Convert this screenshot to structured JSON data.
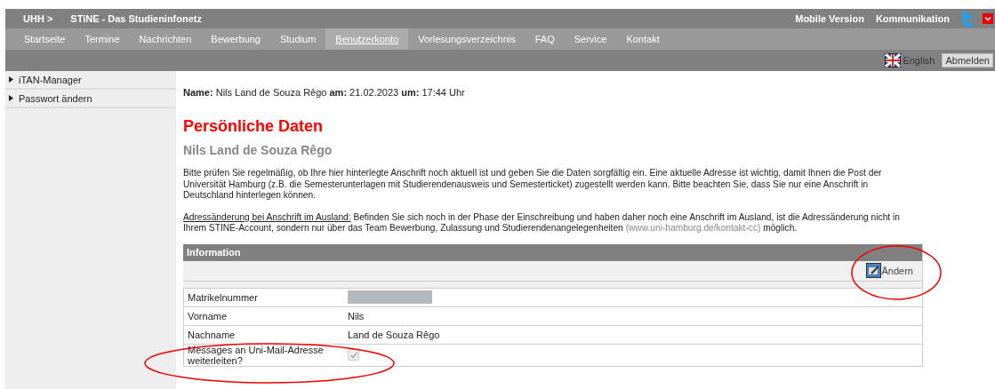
{
  "header": {
    "breadcrumb": "UHH >",
    "title": "STiNE - Das Studieninfonetz",
    "links": [
      "Mobile Version",
      "Kommunikation"
    ]
  },
  "nav": [
    {
      "label": "Startseite",
      "selected": false
    },
    {
      "label": "Termine",
      "selected": false
    },
    {
      "label": "Nachrichten",
      "selected": false
    },
    {
      "label": "Bewerbung",
      "selected": false
    },
    {
      "label": "Studium",
      "selected": false
    },
    {
      "label": "Benutzerkonto",
      "selected": true
    },
    {
      "label": "Vorlesungsverzeichnis",
      "selected": false
    },
    {
      "label": "FAQ",
      "selected": false
    },
    {
      "label": "Service",
      "selected": false
    },
    {
      "label": "Kontakt",
      "selected": false
    }
  ],
  "toolbar": {
    "language": "English",
    "logout": "Abmelden"
  },
  "sidebar": {
    "items": [
      {
        "label": "iTAN-Manager"
      },
      {
        "label": "Passwort ändern"
      }
    ]
  },
  "content": {
    "login_info": "**Name:** Nils Land de Souza Rêgo **am:** 21.02.2023 **um:** 17:44 Uhr",
    "heading": "Persönliche Daten",
    "subheading": "Nils Land de Souza Rêgo",
    "intro": "Bitte prüfen Sie regelmäßig, ob Ihre hier hinterlegte Anschrift noch aktuell ist und geben Sie die Daten sorgfältig ein. Eine aktuelle Adresse ist wichtig, damit Ihnen die Post der Universität Hamburg (z.B. die Semesterunterlagen mit Studierendenausweis und Semesterticket) zugestellt werden kann. Bitte beachten Sie, dass Sie nur eine Anschrift in Deutschland hinterlegen können.",
    "notice": {
      "label": "Adressänderung bei Anschrift im Ausland:",
      "text": "Befinden Sie sich noch in der Phase der Einschreibung und haben daher noch eine Anschrift im Ausland, ist die Adressänderung nicht in Ihrem STINE-Account, sondern nur über das Team Bewerbung, Zulassung und Studierendenangelegenheiten",
      "link": "(www.uni-hamburg.de/kontakt-cc)",
      "tail": "möglich."
    }
  },
  "table": {
    "title": "Information",
    "edit_button": {
      "label": "Ändern",
      "circled": true
    },
    "rows": [
      {
        "label": "Matrikelnummer",
        "kind": "redacted",
        "circled": false
      },
      {
        "label": "Vorname",
        "kind": "text",
        "value": "Nils",
        "circled": false
      },
      {
        "label": "Nachname",
        "kind": "text",
        "value": "Land de Souza Rêgo",
        "circled": false
      },
      {
        "label": "Messages an Uni-Mail-Adresse weiterleiten?",
        "kind": "checkbox",
        "checked": true,
        "disabled": true,
        "circled": true
      }
    ]
  }
}
